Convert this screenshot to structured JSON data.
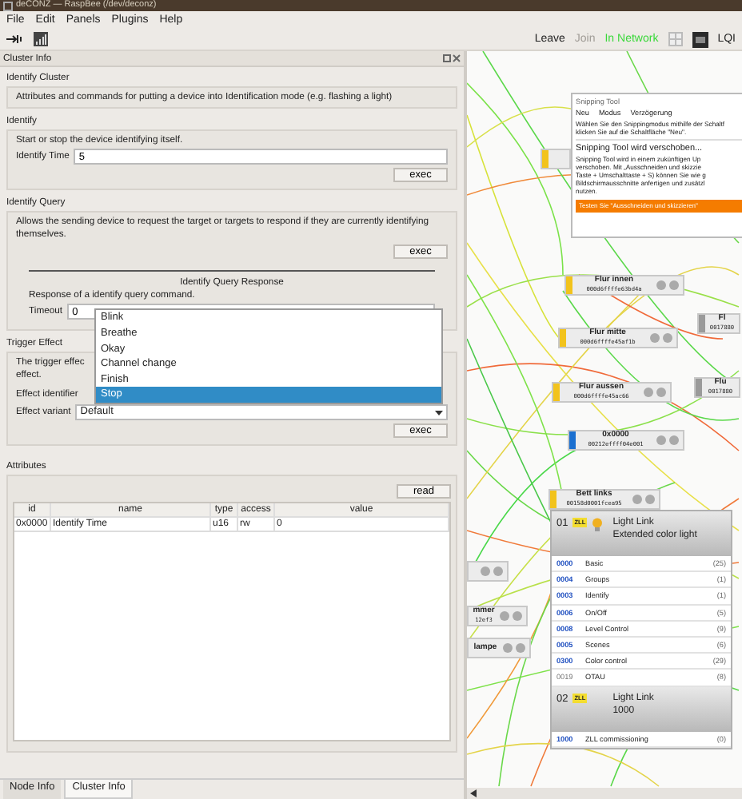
{
  "window": {
    "title": "deCONZ — RaspBee (/dev/deconz)"
  },
  "menu": [
    "File",
    "Edit",
    "Panels",
    "Plugins",
    "Help"
  ],
  "toolbar": {
    "leave": "Leave",
    "join": {
      "label": "Join",
      "disabled": true
    },
    "status": "In Network",
    "lqi": "LQI"
  },
  "cluster_panel": {
    "title": "Cluster Info",
    "identify_cluster": {
      "heading": "Identify Cluster",
      "description": "Attributes and commands for putting a device into Identification mode (e.g. flashing a light)"
    },
    "identify": {
      "heading": "Identify",
      "description": "Start or stop the device identifying itself.",
      "field": {
        "label": "Identify Time",
        "value": "5"
      },
      "button": "exec"
    },
    "identify_query": {
      "heading": "Identify Query",
      "description": "Allows the sending device to request the target or targets to respond if they are currently identifying themselves.",
      "button": "exec",
      "response": {
        "title": "Identify Query Response",
        "description": "Response of a identify query command.",
        "field": {
          "label": "Timeout",
          "value": "0"
        }
      }
    },
    "trigger_effect": {
      "heading": "Trigger Effect",
      "description_lines": [
        "The trigger effec",
        "effect."
      ],
      "identifier_label": "Effect identifier",
      "identifier_options": [
        {
          "label": "Blink",
          "selected": false
        },
        {
          "label": "Breathe",
          "selected": false
        },
        {
          "label": "Okay",
          "selected": false
        },
        {
          "label": "Channel change",
          "selected": false
        },
        {
          "label": "Finish",
          "selected": false
        },
        {
          "label": "Stop",
          "selected": true
        }
      ],
      "variant": {
        "label": "Effect variant",
        "value": "Default"
      },
      "button": "exec"
    },
    "attributes": {
      "heading": "Attributes",
      "button": "read",
      "columns": [
        "id",
        "name",
        "type",
        "access",
        "value"
      ],
      "rows": [
        [
          "0x0000",
          "Identify Time",
          "u16",
          "rw",
          "0"
        ]
      ]
    }
  },
  "bottom_tabs": [
    {
      "label": "Node Info",
      "selected": false
    },
    {
      "label": "Cluster Info",
      "selected": true
    }
  ],
  "node_graph": {
    "nodes": [
      {
        "kind": "clipped",
        "color": "#f2c31c"
      },
      {
        "kind": "full",
        "name": "Flur innen",
        "address": "000d6ffffe63bd4a",
        "color": "#f2c31c"
      },
      {
        "kind": "full",
        "name": "Flur mitte",
        "address": "000d6ffffe45af1b",
        "color": "#f2c31c"
      },
      {
        "kind": "full",
        "name": "Flur aussen",
        "address": "000d6ffffe45ac66",
        "color": "#f2c31c"
      },
      {
        "kind": "full",
        "name": "0x0000",
        "address": "00212effff04e001",
        "color": "#1a6fd0"
      },
      {
        "kind": "full",
        "name": "Bett links",
        "address": "00158d0001fcea95",
        "color": "#f2c31c"
      },
      {
        "kind": "clipped",
        "name": "Fl",
        "address": "0017880",
        "color": "#9a9a9a"
      },
      {
        "kind": "clipped",
        "name": "Flu",
        "address": "0017880",
        "color": "#9a9a9a"
      },
      {
        "kind": "stub"
      },
      {
        "kind": "full",
        "name": "mmer",
        "address": "12ef3"
      },
      {
        "kind": "full",
        "name": "lampe"
      }
    ],
    "device_card": {
      "endpoints": [
        {
          "number": "01",
          "profile": "ZLL",
          "bulb": true,
          "title": "Light Link",
          "subtitle": "Extended color light",
          "clusters": [
            {
              "id": "0000",
              "name": "Basic",
              "count": "(25)",
              "kind": "server"
            },
            {
              "id": "0004",
              "name": "Groups",
              "count": "(1)",
              "kind": "server"
            },
            {
              "id": "0003",
              "name": "Identify",
              "count": "(1)",
              "kind": "server"
            },
            {
              "id": "0006",
              "name": "On/Off",
              "count": "(5)",
              "kind": "server"
            },
            {
              "id": "0008",
              "name": "Level Control",
              "count": "(9)",
              "kind": "server"
            },
            {
              "id": "0005",
              "name": "Scenes",
              "count": "(6)",
              "kind": "server"
            },
            {
              "id": "0300",
              "name": "Color control",
              "count": "(29)",
              "kind": "server"
            },
            {
              "id": "0019",
              "name": "OTAU",
              "count": "(8)",
              "kind": "client"
            }
          ]
        },
        {
          "number": "02",
          "profile": "ZLL",
          "bulb": false,
          "title": "Light Link",
          "subtitle": "1000",
          "clusters": [
            {
              "id": "1000",
              "name": "ZLL commissioning",
              "count": "(0)",
              "kind": "server"
            }
          ]
        }
      ]
    }
  },
  "snipping_tool": {
    "title": "Snipping Tool",
    "toolbar": [
      "Neu",
      "Modus",
      "Verzögerung"
    ],
    "instruction_lines": [
      "Wählen Sie den Snippingmodus mithilfe der Schaltf",
      "klicken Sie auf die Schaltfläche \"Neu\"."
    ],
    "notice": {
      "heading": "Snipping Tool wird verschoben...",
      "lines": [
        "Snipping Tool wird in einem zukünftigen Up",
        "verschoben. Mit „Ausschneiden und skizzie",
        "Taste + Umschalttaste + S) können Sie wie g",
        "Bildschirmausschnitte anfertigen und zusätzl",
        "nutzen."
      ],
      "button": "Testen Sie \"Ausschneiden und skizzieren\""
    }
  }
}
